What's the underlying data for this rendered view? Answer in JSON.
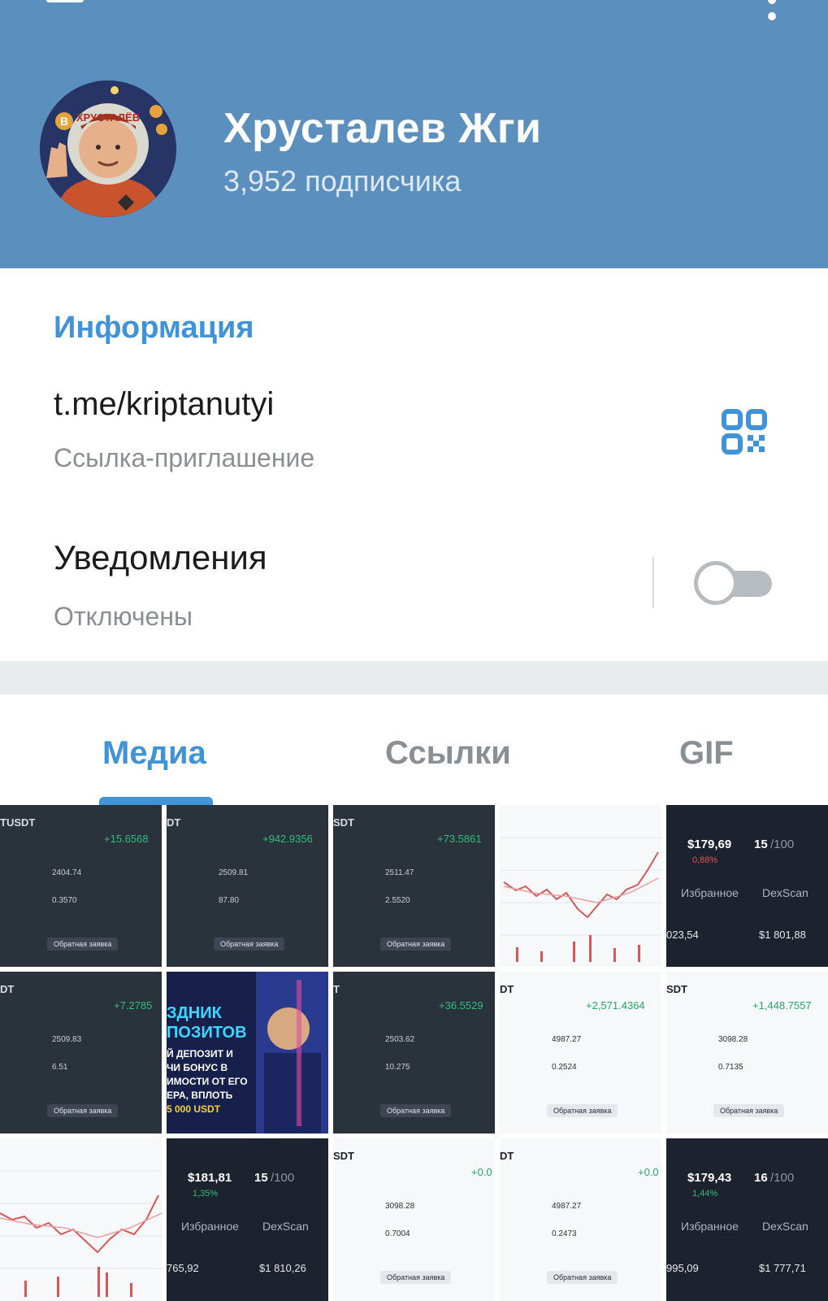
{
  "header": {
    "title": "Хрусталев Жги",
    "subscribers": "3,952 подписчика",
    "avatar_text": "ХРУСТАЛЁВ",
    "colors": {
      "bar": "#5b8fbe",
      "accent": "#3f93d6"
    }
  },
  "info": {
    "heading": "Информация",
    "link": "t.me/kriptanutyi",
    "link_label": "Ссылка-приглашение",
    "notifications_title": "Уведомления",
    "notifications_state": "Отключены",
    "notifications_enabled": false
  },
  "tabs": [
    {
      "label": "Медиа",
      "active": true
    },
    {
      "label": "Ссылки",
      "active": false
    },
    {
      "label": "GIF",
      "active": false
    }
  ],
  "media": {
    "row1": [
      {
        "pair": "TUSDT",
        "pnl": "+15.6568",
        "v1": "2404.74",
        "v2": "0.3570",
        "b1": "Обратная заявка"
      },
      {
        "pair": "DT",
        "pnl": "+942.9356",
        "v1": "2509.81",
        "v2": "87.80",
        "b1": "Обратная заявка"
      },
      {
        "pair": "SDT",
        "pnl": "+73.5861",
        "v1": "2511.47",
        "v2": "2.5520",
        "b1": "Обратная заявка"
      },
      {
        "kind": "chart"
      },
      {
        "price": "$179,69",
        "change": "0,88%",
        "count": "15",
        "of": "/100",
        "fav": "Избранное",
        "dex": "DexScan",
        "bottom_left": "023,54",
        "bottom_right": "$1 801,88"
      }
    ],
    "row2": [
      {
        "pair": "DT",
        "pnl": "+7.2785",
        "v1": "2509.83",
        "v2": "6.51",
        "b1": "Обратная заявка"
      },
      {
        "promo": [
          "ЗДНИК",
          "ПОЗИТОВ",
          "Й ДЕПОЗИТ И",
          "ЧИ БОНУС В",
          "ИМОСТИ ОТ ЕГО",
          "ЕРА, ВПЛОТЬ",
          "5 000 USDT"
        ]
      },
      {
        "pair": "T",
        "pnl": "+36.5529",
        "v1": "2503.62",
        "v2": "10.275",
        "b1": "Обратная заявка"
      },
      {
        "pair": "DT",
        "pnl": "+2,571.4364",
        "v1": "4987.27",
        "v2": "0.2524",
        "b1": "Обратная заявка"
      },
      {
        "pair": "SDT",
        "pnl": "+1,448.7557",
        "v1": "3098.28",
        "v2": "0.7135",
        "b1": "Обратная заявка"
      }
    ],
    "row3": [
      {
        "kind": "chart"
      },
      {
        "price": "$181,81",
        "change": "1,35%",
        "count": "15",
        "of": "/100",
        "fav": "Избранное",
        "dex": "DexScan",
        "bottom_left": "765,92",
        "bottom_right": "$1 810,26"
      },
      {
        "pair": "SDT",
        "pnl": "+0.0",
        "v1": "3098.28",
        "v2": "0.7004",
        "b1": "Обратная заявка"
      },
      {
        "pair": "DT",
        "pnl": "+0.0",
        "v1": "4987.27",
        "v2": "0.2473",
        "b1": "Обратная заявка"
      },
      {
        "price": "$179,43",
        "change": "1,44%",
        "count": "16",
        "of": "/100",
        "fav": "Избранное",
        "dex": "DexScan",
        "bottom_left": "995,09",
        "bottom_right": "$1 777,71"
      }
    ]
  }
}
